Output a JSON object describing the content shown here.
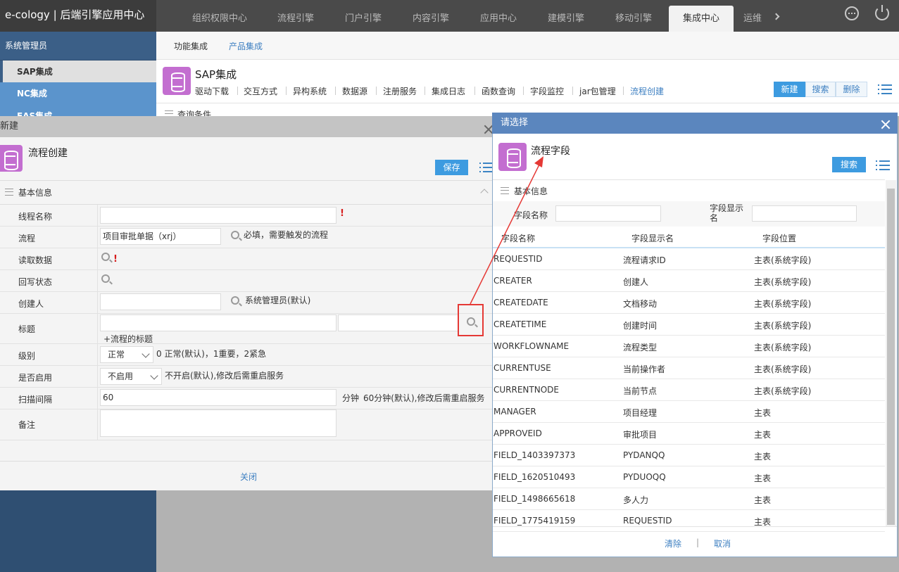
{
  "app": {
    "title": "e-cology | 后端引擎应用中心"
  },
  "top_nav": [
    "组织权限中心",
    "流程引擎",
    "门户引擎",
    "内容引擎",
    "应用中心",
    "建模引擎",
    "移动引擎",
    "集成中心",
    "运维"
  ],
  "top_nav_active": "集成中心",
  "sidebar": {
    "title": "系统管理员",
    "items": [
      "SAP集成",
      "NC集成",
      "EAS集成"
    ]
  },
  "sub_nav": [
    "功能集成",
    "产品集成"
  ],
  "sap": {
    "title": "SAP集成",
    "tabs": [
      "驱动下载",
      "交互方式",
      "异构系统",
      "数据源",
      "注册服务",
      "集成日志",
      "函数查询",
      "字段监控",
      "jar包管理",
      "流程创建"
    ],
    "buttons": {
      "new": "新建",
      "search": "搜索",
      "delete": "删除"
    },
    "query_label": "查询条件"
  },
  "dialog_new": {
    "header": "新建",
    "title": "流程创建",
    "save": "保存",
    "section": "基本信息",
    "fields": {
      "name": {
        "label": "线程名称",
        "value": ""
      },
      "workflow": {
        "label": "流程",
        "value": "项目审批单据（xrj）",
        "hint": "必填，需要触发的流程"
      },
      "read": {
        "label": "读取数据"
      },
      "writeback": {
        "label": "回写状态"
      },
      "creator": {
        "label": "创建人",
        "hint": "系统管理员(默认)"
      },
      "title": {
        "label": "标题",
        "hint": "+流程的标题"
      },
      "level": {
        "label": "级别",
        "value": "正常",
        "hint": "0 正常(默认)，1重要，2紧急"
      },
      "enabled": {
        "label": "是否启用",
        "value": "不启用",
        "hint": "不开启(默认),修改后需重启服务"
      },
      "interval": {
        "label": "扫描间隔",
        "value": "60",
        "unit": "分钟",
        "hint": "60分钟(默认),修改后需重启服务"
      },
      "remark": {
        "label": "备注"
      }
    },
    "close": "关闭"
  },
  "dialog_pick": {
    "header": "请选择",
    "title": "流程字段",
    "search": "搜索",
    "section": "基本信息",
    "filter": {
      "field_name": "字段名称",
      "display_name": "字段显示名"
    },
    "columns": [
      "字段名称",
      "字段显示名",
      "字段位置"
    ],
    "rows": [
      [
        "REQUESTID",
        "流程请求ID",
        "主表(系统字段)"
      ],
      [
        "CREATER",
        "创建人",
        "主表(系统字段)"
      ],
      [
        "CREATEDATE",
        "文档移动",
        "主表(系统字段)"
      ],
      [
        "CREATETIME",
        "创建时间",
        "主表(系统字段)"
      ],
      [
        "WORKFLOWNAME",
        "流程类型",
        "主表(系统字段)"
      ],
      [
        "CURRENTUSE",
        "当前操作者",
        "主表(系统字段)"
      ],
      [
        "CURRENTNODE",
        "当前节点",
        "主表(系统字段)"
      ],
      [
        "MANAGER",
        "项目经理",
        "主表"
      ],
      [
        "APPROVEID",
        "审批项目",
        "主表"
      ],
      [
        "FIELD_1403397373",
        "PYDANQQ",
        "主表"
      ],
      [
        "FIELD_1620510493",
        "PYDUOQQ",
        "主表"
      ],
      [
        "FIELD_1498665618",
        "多人力",
        "主表"
      ],
      [
        "FIELD_1775419159",
        "REQUESTID",
        "主表"
      ]
    ],
    "footer": {
      "clear": "清除",
      "sep": "|",
      "cancel": "取消"
    }
  },
  "colors": {
    "accent": "#3d9be0",
    "annotation": "#e53935",
    "picker_header": "#5b86be"
  }
}
